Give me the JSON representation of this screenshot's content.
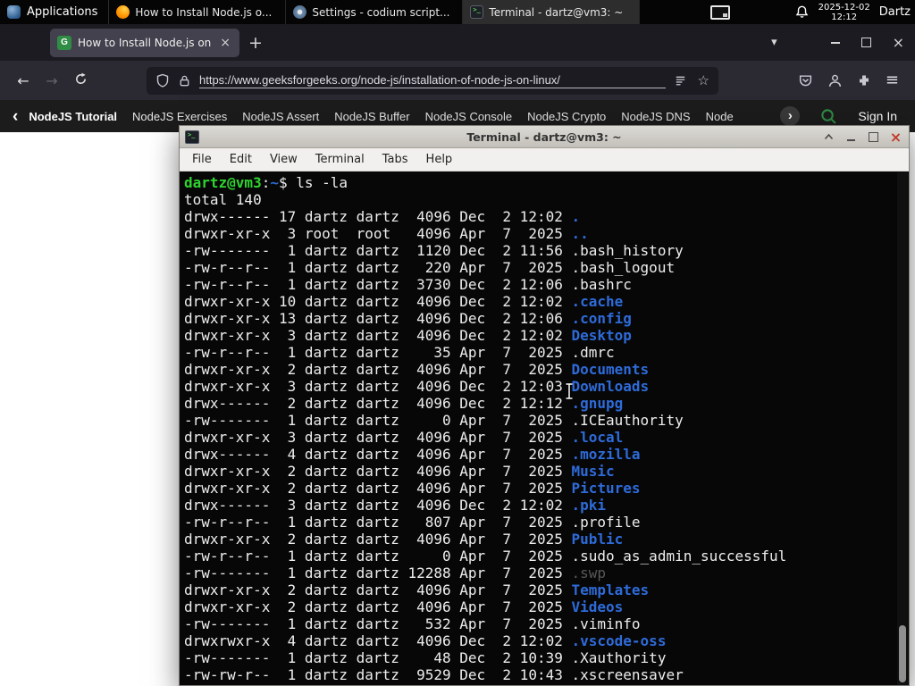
{
  "colors": {
    "gfg_green": "#2f8d46",
    "prompt_green": "#2fd42f",
    "dir_blue": "#2e6bd9",
    "close_red": "#c13b2a"
  },
  "glyphs": {
    "back": "←",
    "forward": "→",
    "new_tab": "+",
    "close": "×",
    "tab_list": "▾",
    "menu": "≡",
    "star": "☆",
    "chevron_left": "‹",
    "chevron_right": "›",
    "favicon_letter": "G"
  },
  "panel": {
    "applications": "Applications",
    "tasks": [
      {
        "title": "How to Install Node.js o...",
        "icon": "firefox",
        "active": false
      },
      {
        "title": "Settings - codium script...",
        "icon": "settings",
        "active": false
      },
      {
        "title": "Terminal - dartz@vm3: ~",
        "icon": "terminal",
        "active": true
      }
    ],
    "clock": {
      "date": "2025-12-02",
      "time": "12:12"
    },
    "user": "Dartz"
  },
  "browser": {
    "tab_title": "How to Install Node.js on",
    "url": "https://www.geeksforgeeks.org/node-js/installation-of-node-js-on-linux/"
  },
  "gfg_nav": {
    "items": [
      {
        "label": "NodeJS Tutorial",
        "bold": true
      },
      {
        "label": "NodeJS Exercises",
        "bold": false
      },
      {
        "label": "NodeJS Assert",
        "bold": false
      },
      {
        "label": "NodeJS Buffer",
        "bold": false
      },
      {
        "label": "NodeJS Console",
        "bold": false
      },
      {
        "label": "NodeJS Crypto",
        "bold": false
      },
      {
        "label": "NodeJS DNS",
        "bold": false
      },
      {
        "label": "Node",
        "bold": false
      }
    ],
    "sign_in": "Sign In"
  },
  "terminal": {
    "title": "Terminal - dartz@vm3: ~",
    "menu": [
      "File",
      "Edit",
      "View",
      "Terminal",
      "Tabs",
      "Help"
    ],
    "prompt": {
      "user_host": "dartz@vm3",
      "separator": ":",
      "path": "~",
      "symbol": "$",
      "command": " ls -la"
    },
    "total": "total 140",
    "listing": [
      {
        "pre": "drwx------ 17 dartz dartz  4096 Dec  2 12:02 ",
        "name": ".",
        "cls": "dir"
      },
      {
        "pre": "drwxr-xr-x  3 root  root   4096 Apr  7  2025 ",
        "name": "..",
        "cls": "dir"
      },
      {
        "pre": "-rw-------  1 dartz dartz  1120 Dec  2 11:56 ",
        "name": ".bash_history",
        "cls": "file"
      },
      {
        "pre": "-rw-r--r--  1 dartz dartz   220 Apr  7  2025 ",
        "name": ".bash_logout",
        "cls": "file"
      },
      {
        "pre": "-rw-r--r--  1 dartz dartz  3730 Dec  2 12:06 ",
        "name": ".bashrc",
        "cls": "file"
      },
      {
        "pre": "drwxr-xr-x 10 dartz dartz  4096 Dec  2 12:02 ",
        "name": ".cache",
        "cls": "dir"
      },
      {
        "pre": "drwxr-xr-x 13 dartz dartz  4096 Dec  2 12:06 ",
        "name": ".config",
        "cls": "dir"
      },
      {
        "pre": "drwxr-xr-x  3 dartz dartz  4096 Dec  2 12:02 ",
        "name": "Desktop",
        "cls": "dir"
      },
      {
        "pre": "-rw-r--r--  1 dartz dartz    35 Apr  7  2025 ",
        "name": ".dmrc",
        "cls": "file"
      },
      {
        "pre": "drwxr-xr-x  2 dartz dartz  4096 Apr  7  2025 ",
        "name": "Documents",
        "cls": "dir"
      },
      {
        "pre": "drwxr-xr-x  3 dartz dartz  4096 Dec  2 12:03 ",
        "name": "Downloads",
        "cls": "dir"
      },
      {
        "pre": "drwx------  2 dartz dartz  4096 Dec  2 12:12 ",
        "name": ".gnupg",
        "cls": "dir"
      },
      {
        "pre": "-rw-------  1 dartz dartz     0 Apr  7  2025 ",
        "name": ".ICEauthority",
        "cls": "file"
      },
      {
        "pre": "drwxr-xr-x  3 dartz dartz  4096 Apr  7  2025 ",
        "name": ".local",
        "cls": "dir"
      },
      {
        "pre": "drwx------  4 dartz dartz  4096 Apr  7  2025 ",
        "name": ".mozilla",
        "cls": "dir"
      },
      {
        "pre": "drwxr-xr-x  2 dartz dartz  4096 Apr  7  2025 ",
        "name": "Music",
        "cls": "dir"
      },
      {
        "pre": "drwxr-xr-x  2 dartz dartz  4096 Apr  7  2025 ",
        "name": "Pictures",
        "cls": "dir"
      },
      {
        "pre": "drwx------  3 dartz dartz  4096 Dec  2 12:02 ",
        "name": ".pki",
        "cls": "dir"
      },
      {
        "pre": "-rw-r--r--  1 dartz dartz   807 Apr  7  2025 ",
        "name": ".profile",
        "cls": "file"
      },
      {
        "pre": "drwxr-xr-x  2 dartz dartz  4096 Apr  7  2025 ",
        "name": "Public",
        "cls": "dir"
      },
      {
        "pre": "-rw-r--r--  1 dartz dartz     0 Apr  7  2025 ",
        "name": ".sudo_as_admin_successful",
        "cls": "file"
      },
      {
        "pre": "-rw-------  1 dartz dartz 12288 Apr  7  2025 ",
        "name": ".swp",
        "cls": "dim"
      },
      {
        "pre": "drwxr-xr-x  2 dartz dartz  4096 Apr  7  2025 ",
        "name": "Templates",
        "cls": "dir"
      },
      {
        "pre": "drwxr-xr-x  2 dartz dartz  4096 Apr  7  2025 ",
        "name": "Videos",
        "cls": "dir"
      },
      {
        "pre": "-rw-------  1 dartz dartz   532 Apr  7  2025 ",
        "name": ".viminfo",
        "cls": "file"
      },
      {
        "pre": "drwxrwxr-x  4 dartz dartz  4096 Dec  2 12:02 ",
        "name": ".vscode-oss",
        "cls": "dir"
      },
      {
        "pre": "-rw-------  1 dartz dartz    48 Dec  2 10:39 ",
        "name": ".Xauthority",
        "cls": "file"
      },
      {
        "pre": "-rw-rw-r--  1 dartz dartz  9529 Dec  2 10:43 ",
        "name": ".xscreensaver",
        "cls": "file"
      }
    ]
  }
}
